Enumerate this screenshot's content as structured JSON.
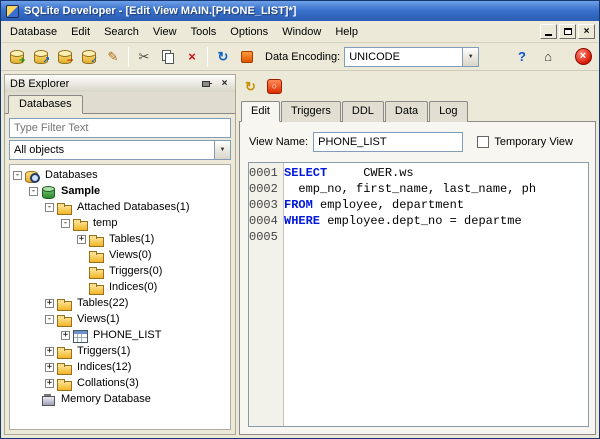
{
  "window": {
    "title": "SQLite Developer - [Edit View MAIN.[PHONE_LIST]*]"
  },
  "menubar": {
    "items": [
      "Database",
      "Edit",
      "Search",
      "View",
      "Tools",
      "Options",
      "Window",
      "Help"
    ]
  },
  "icons": {
    "dropdown_arrow": "▼",
    "close": "×",
    "pin": "css-pushpin",
    "minimize": "css-bar",
    "restore": "css-window",
    "database": "css-cylinder",
    "folder": "css-folder",
    "table": "css-grid",
    "memory": "css-chip"
  },
  "toolbar": {
    "buttons": [
      {
        "name": "new-database-button",
        "type": "db",
        "overlay": "+",
        "ocolor": "#189518"
      },
      {
        "name": "open-database-button",
        "type": "db",
        "overlay": "↗",
        "ocolor": "#0b62c4"
      },
      {
        "name": "close-database-button",
        "type": "db",
        "overlay": "−",
        "ocolor": "#cc2200"
      },
      {
        "name": "attach-database-button",
        "type": "db",
        "overlay": "✓",
        "ocolor": "#0b62c4"
      },
      {
        "name": "edit-database-button",
        "type": "glyph",
        "glyph": "✎",
        "color": "#b06a10"
      },
      {
        "type": "sep"
      },
      {
        "name": "cut-button",
        "type": "glyph",
        "glyph": "✂",
        "color": "#444"
      },
      {
        "name": "copy-button",
        "type": "copy"
      },
      {
        "name": "delete-button",
        "type": "glyph",
        "glyph": "×",
        "color": "#cc1111",
        "bold": true
      },
      {
        "type": "sep"
      },
      {
        "name": "refresh-button",
        "type": "glyph",
        "glyph": "↻",
        "color": "#0b62c4",
        "bold": true
      },
      {
        "name": "stop-refresh-button",
        "type": "stopsm"
      }
    ],
    "data_encoding_label": "Data Encoding:",
    "encoding_value": "UNICODE",
    "right_buttons": [
      {
        "name": "help-button",
        "type": "glyph",
        "glyph": "?",
        "color": "#0b52cc",
        "bold": true
      },
      {
        "name": "home-button",
        "type": "glyph",
        "glyph": "⌂",
        "color": "#333"
      },
      {
        "name": "exit-button",
        "type": "exit"
      }
    ]
  },
  "explorer": {
    "title": "DB Explorer",
    "tab_label": "Databases",
    "filter_text": "Type Filter Text",
    "objects_value": "All objects",
    "tree": [
      {
        "label": "Databases",
        "depth": 0,
        "icon": "db-search",
        "toggle": "minus",
        "bold": false
      },
      {
        "label": "Sample",
        "depth": 1,
        "icon": "db-green",
        "toggle": "minus",
        "bold": true
      },
      {
        "label": "Attached Databases(1)",
        "depth": 2,
        "icon": "folder",
        "toggle": "minus",
        "bold": false
      },
      {
        "label": "temp",
        "depth": 3,
        "icon": "folder",
        "toggle": "minus",
        "bold": false
      },
      {
        "label": "Tables(1)",
        "depth": 4,
        "icon": "folder",
        "toggle": "plus",
        "bold": false
      },
      {
        "label": "Views(0)",
        "depth": 4,
        "icon": "folder",
        "toggle": "none",
        "bold": false
      },
      {
        "label": "Triggers(0)",
        "depth": 4,
        "icon": "folder",
        "toggle": "none",
        "bold": false
      },
      {
        "label": "Indices(0)",
        "depth": 4,
        "icon": "folder",
        "toggle": "none",
        "bold": false
      },
      {
        "label": "Tables(22)",
        "depth": 2,
        "icon": "folder",
        "toggle": "plus",
        "bold": false
      },
      {
        "label": "Views(1)",
        "depth": 2,
        "icon": "folder",
        "toggle": "minus",
        "bold": false
      },
      {
        "label": "PHONE_LIST",
        "depth": 3,
        "icon": "table-grid",
        "toggle": "plus",
        "bold": false
      },
      {
        "label": "Triggers(1)",
        "depth": 2,
        "icon": "folder",
        "toggle": "plus",
        "bold": false
      },
      {
        "label": "Indices(12)",
        "depth": 2,
        "icon": "folder",
        "toggle": "plus",
        "bold": false
      },
      {
        "label": "Collations(3)",
        "depth": 2,
        "icon": "folder",
        "toggle": "plus",
        "bold": false
      },
      {
        "label": "Memory Database",
        "depth": 1,
        "icon": "memory",
        "toggle": "none",
        "bold": false
      }
    ]
  },
  "view_editor": {
    "mini_buttons": [
      {
        "name": "refresh-view-button",
        "type": "glyph",
        "glyph": "↻",
        "color": "#c89000",
        "bold": true
      },
      {
        "name": "abort-button",
        "type": "stopview",
        "glyph": "○"
      }
    ],
    "tabs": [
      "Edit",
      "Triggers",
      "DDL",
      "Data",
      "Log"
    ],
    "active_tab": "Edit",
    "view_name_label": "View Name:",
    "view_name_value": "PHONE_LIST",
    "temporary_view_label": "Temporary View",
    "keyword_color": "#0018dd",
    "watermark": "CWER.ws",
    "code_lines": [
      {
        "num": "0001",
        "segments": [
          {
            "text": "SELECT",
            "kw": true
          },
          {
            "text": "     CWER.ws",
            "kw": false
          }
        ]
      },
      {
        "num": "0002",
        "segments": [
          {
            "text": "  emp_no, first_name, last_name, ph",
            "kw": false
          }
        ]
      },
      {
        "num": "0003",
        "segments": [
          {
            "text": "FROM",
            "kw": true
          },
          {
            "text": " employee, department",
            "kw": false
          }
        ]
      },
      {
        "num": "0004",
        "segments": [
          {
            "text": "WHERE",
            "kw": true
          },
          {
            "text": " employee.dept_no = departme",
            "kw": false
          }
        ]
      },
      {
        "num": "0005",
        "segments": []
      }
    ]
  }
}
